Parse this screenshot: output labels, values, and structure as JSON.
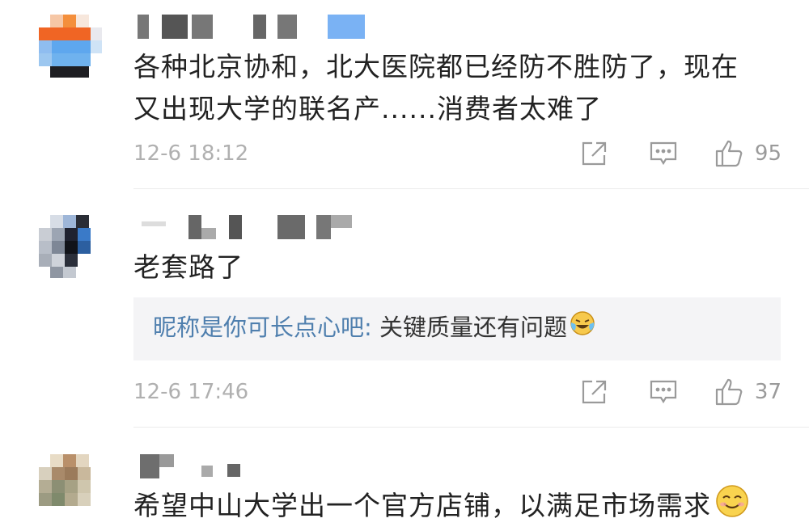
{
  "comments": [
    {
      "text_lines": [
        "各种北京协和，北大医院都已经防不胜防了，现在",
        "又出现大学的联名产......消费者太难了"
      ],
      "timestamp": "12-6 18:12",
      "likes": "95"
    },
    {
      "text_lines": [
        "老套路了"
      ],
      "reply": {
        "name": "昵称是你可长点心吧:",
        "text": " 关键质量还有问题"
      },
      "timestamp": "12-6 17:46",
      "likes": "37"
    },
    {
      "text_lines": [
        "希望中山大学出一个官方店铺，以满足市场需求"
      ]
    }
  ],
  "icons": {
    "share": "share-icon",
    "comment": "comment-icon",
    "like": "thumbs-up-icon",
    "laugh_cry": "laughing-crying-emoji",
    "smile": "smiling-emoji"
  },
  "colors": {
    "text": "#222222",
    "meta": "#b0b0b0",
    "reply_name": "#4f7fae",
    "reply_bg": "#f4f4f6"
  }
}
